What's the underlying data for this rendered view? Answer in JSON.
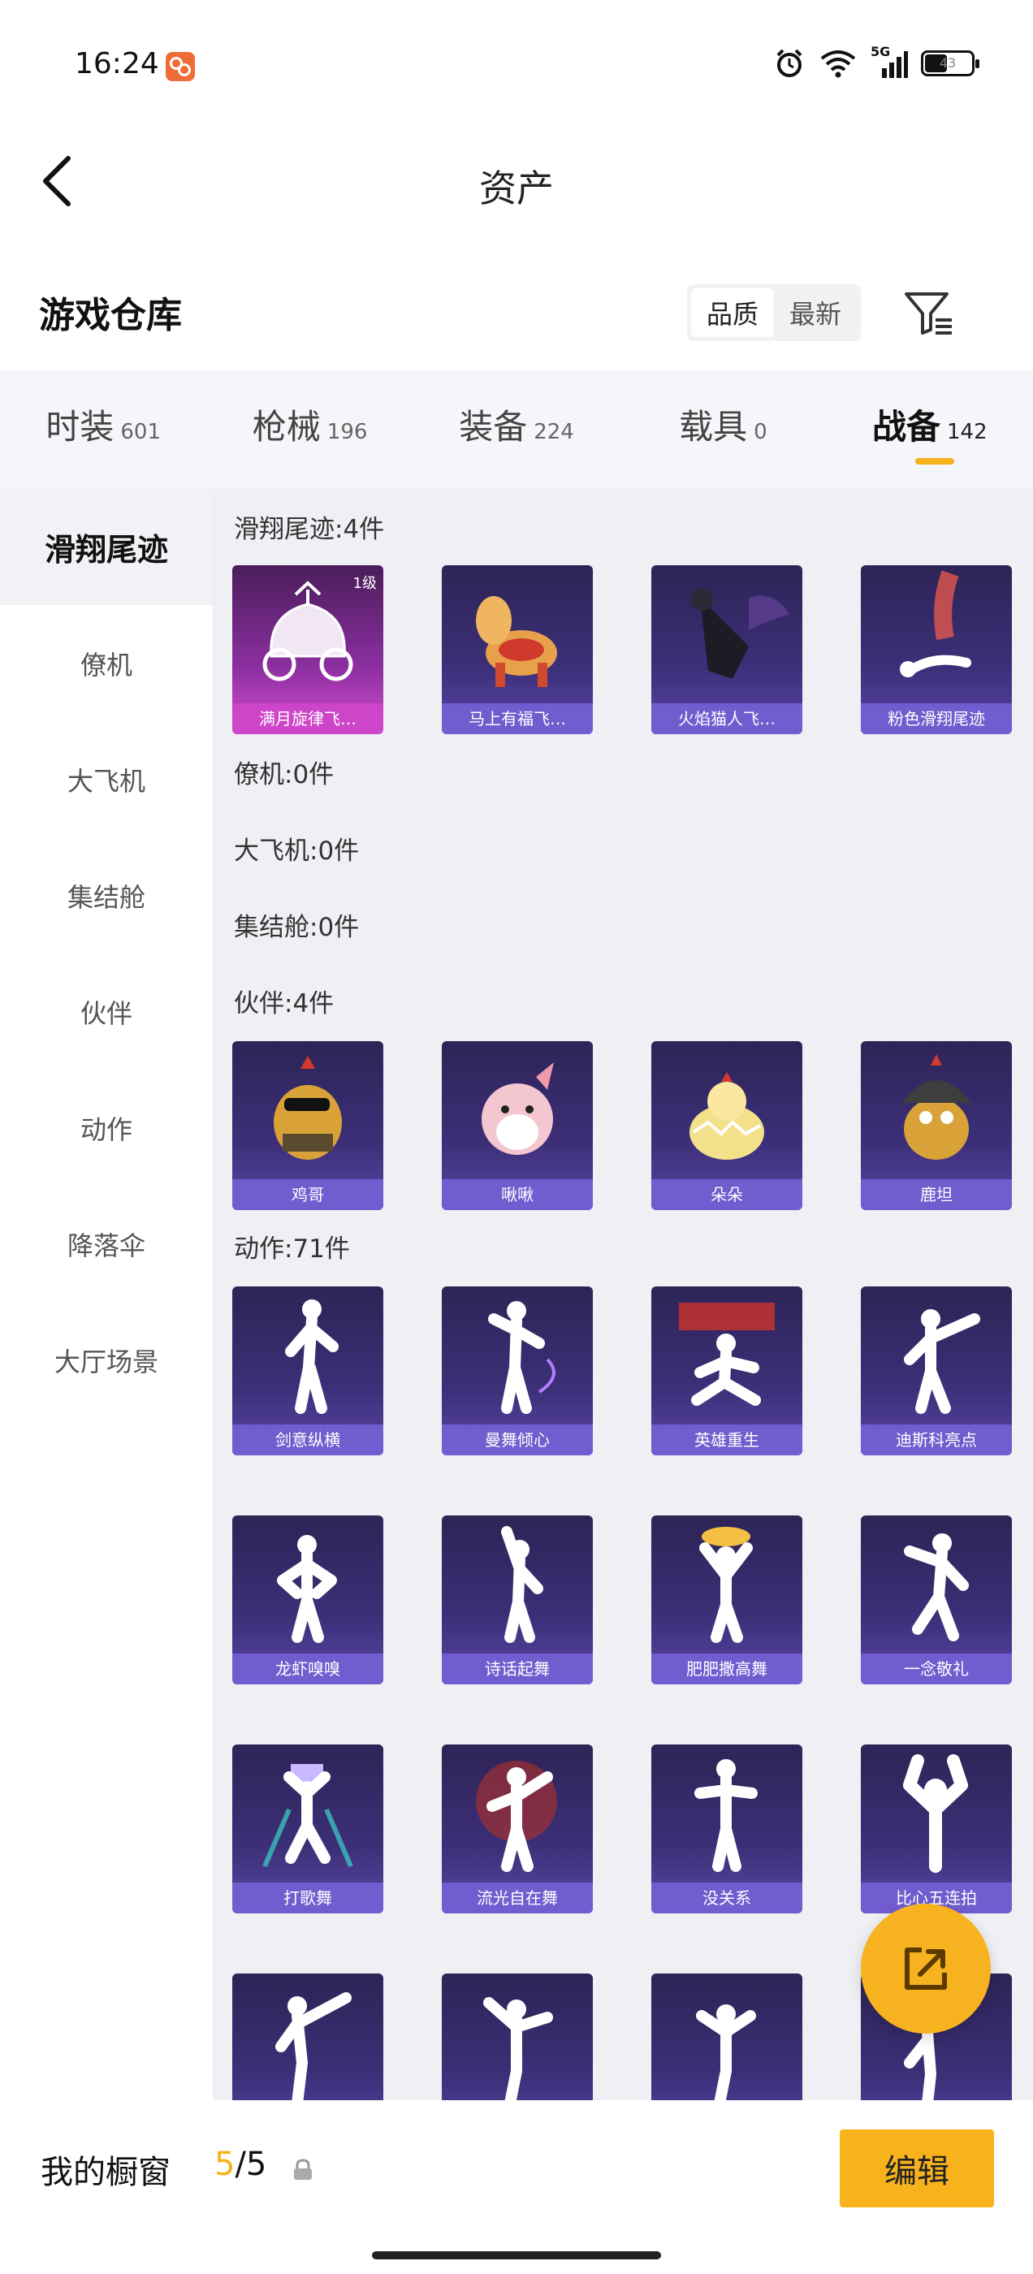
{
  "status_bar": {
    "time": "16:24",
    "network": "5G",
    "battery": "43"
  },
  "header": {
    "title": "资产"
  },
  "warehouse": {
    "title": "游戏仓库",
    "sort_options": [
      "品质",
      "最新"
    ]
  },
  "category_tabs": [
    {
      "label": "时装",
      "count": "601"
    },
    {
      "label": "枪械",
      "count": "196"
    },
    {
      "label": "装备",
      "count": "224"
    },
    {
      "label": "载具",
      "count": "0"
    },
    {
      "label": "战备",
      "count": "142"
    }
  ],
  "sidebar": {
    "items": [
      "滑翔尾迹",
      "僚机",
      "大飞机",
      "集结舱",
      "伙伴",
      "动作",
      "降落伞",
      "大厅场景"
    ]
  },
  "sections": {
    "glide": {
      "header": "滑翔尾迹:4件",
      "items": [
        {
          "name": "满月旋律飞…",
          "level": "1级"
        },
        {
          "name": "马上有福飞…"
        },
        {
          "name": "火焰猫人飞…"
        },
        {
          "name": "粉色滑翔尾迹"
        }
      ]
    },
    "wingman": {
      "header": "僚机:0件"
    },
    "plane": {
      "header": "大飞机:0件"
    },
    "pod": {
      "header": "集结舱:0件"
    },
    "partner": {
      "header": "伙伴:4件",
      "items": [
        {
          "name": "鸡哥"
        },
        {
          "name": "啾啾"
        },
        {
          "name": "朵朵"
        },
        {
          "name": "鹿坦"
        }
      ]
    },
    "emote": {
      "header": "动作:71件",
      "items": [
        {
          "name": "剑意纵横"
        },
        {
          "name": "曼舞倾心"
        },
        {
          "name": "英雄重生"
        },
        {
          "name": "迪斯科亮点"
        },
        {
          "name": "龙虾嗅嗅"
        },
        {
          "name": "诗话起舞"
        },
        {
          "name": "肥肥撒高舞"
        },
        {
          "name": "一念敬礼"
        },
        {
          "name": "打歌舞"
        },
        {
          "name": "流光自在舞"
        },
        {
          "name": "没关系"
        },
        {
          "name": "比心五连拍"
        },
        {
          "name": ""
        },
        {
          "name": ""
        },
        {
          "name": ""
        },
        {
          "name": ""
        }
      ]
    }
  },
  "bottom_bar": {
    "label": "我的橱窗",
    "count_current": "5",
    "count_total": "/5",
    "edit_label": "编辑"
  }
}
